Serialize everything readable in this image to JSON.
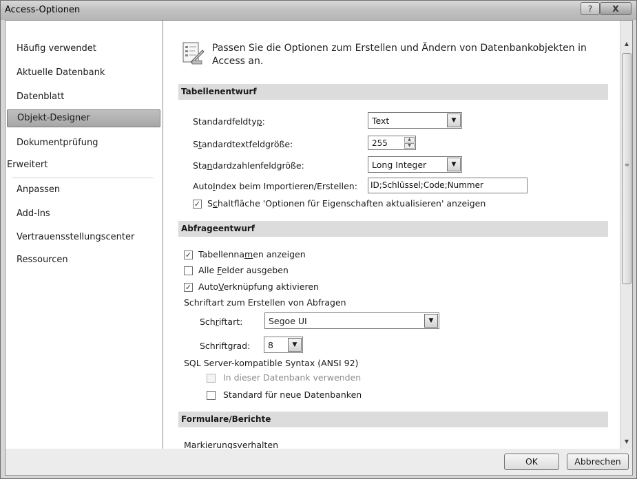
{
  "window": {
    "title": "Access-Optionen",
    "help_glyph": "?",
    "close_glyph": "X"
  },
  "sidebar": {
    "items": [
      {
        "label": "Häufig verwendet"
      },
      {
        "label": "Aktuelle Datenbank"
      },
      {
        "label": "Datenblatt"
      },
      {
        "label": "Objekt-Designer",
        "selected": true
      },
      {
        "label": "Dokumentprüfung"
      },
      {
        "label": "Erweitert"
      },
      {
        "label": "Anpassen"
      },
      {
        "label": "Add-Ins"
      },
      {
        "label": "Vertrauensstellungscenter"
      },
      {
        "label": "Ressourcen"
      }
    ]
  },
  "header": {
    "icon": "designer-options-icon",
    "text": "Passen Sie die Optionen zum Erstellen und Ändern von Datenbankobjekten in Access an."
  },
  "sections": {
    "table_design": "Tabellenentwurf",
    "query_design": "Abfrageentwurf",
    "forms_reports": "Formulare/Berichte"
  },
  "table_design": {
    "default_field_type": {
      "label_pre": "Standardfeldty",
      "label_key": "p",
      "label_post": ":",
      "value": "Text"
    },
    "default_text_size": {
      "label_pre": "S",
      "label_key": "t",
      "label_post": "andardtextfeldgröße:",
      "value": "255"
    },
    "default_number_size": {
      "label_pre": "Sta",
      "label_key": "n",
      "label_post": "dardzahlenfeldgröße:",
      "value": "Long Integer"
    },
    "autoindex": {
      "label_pre": "Auto",
      "label_key": "I",
      "label_post": "ndex beim Importieren/Erstellen:",
      "value": "ID;Schlüssel;Code;Nummer"
    },
    "show_property_button": {
      "label_pre": "S",
      "label_key": "c",
      "label_post": "haltfläche 'Optionen für Eigenschaften aktualisieren' anzeigen",
      "checked": true
    }
  },
  "query_design": {
    "show_table_names": {
      "label_pre": "Tabellenna",
      "label_key": "m",
      "label_post": "en anzeigen",
      "checked": true
    },
    "output_all_fields": {
      "label_pre": "Alle ",
      "label_key": "F",
      "label_post": "elder ausgeben",
      "checked": false
    },
    "autojoin": {
      "label_pre": "Auto",
      "label_key": "V",
      "label_post": "erknüpfung aktivieren",
      "checked": true
    },
    "query_font_heading": "Schriftart zum Erstellen von Abfragen",
    "font": {
      "label_pre": "Sch",
      "label_key": "r",
      "label_post": "iftart:",
      "value": "Segoe UI"
    },
    "font_size": {
      "label_pre": "Schrift",
      "label_key": "g",
      "label_post": "rad:",
      "value": "8"
    },
    "sql_heading": "SQL Server-kompatible Syntax (ANSI 92)",
    "use_in_db": {
      "label": "In dieser Datenbank verwenden",
      "checked": false,
      "disabled": true
    },
    "default_new_db": {
      "label": "Standard für neue Datenbanken",
      "checked": false
    }
  },
  "forms_reports": {
    "selection_behavior": "Markierungsverhalten"
  },
  "footer": {
    "ok": "OK",
    "cancel": "Abbrechen"
  },
  "glyphs": {
    "check": "✓",
    "dropdown": "▼",
    "up": "▲",
    "down": "▼",
    "grip": "≡"
  }
}
